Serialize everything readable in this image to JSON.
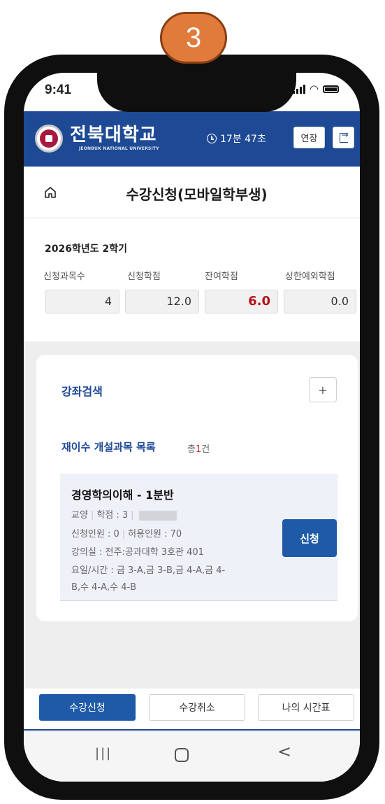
{
  "step_badge": "3",
  "status_bar": {
    "time": "9:41"
  },
  "header": {
    "university_name": "전북대학교",
    "university_name_en": "JEONBUK NATIONAL UNIVERSITY",
    "timer": "17분 47초",
    "extend_label": "연장",
    "brand_color": "#1e4a95"
  },
  "page": {
    "title": "수강신청(모바일학부생)"
  },
  "summary": {
    "term": "2026학년도 2학기",
    "items": [
      {
        "label": "신청과목수",
        "value": "4"
      },
      {
        "label": "신청학점",
        "value": "12.0"
      },
      {
        "label": "잔여학점",
        "value": "6.0"
      },
      {
        "label": "상한예외학점",
        "value": "0.0"
      }
    ]
  },
  "search": {
    "title": "강좌검색",
    "expand_label": "+"
  },
  "course_list": {
    "title": "재이수 개설과목 목록",
    "total_prefix": "총",
    "total_count": "1",
    "total_suffix": "건",
    "courses": [
      {
        "name": "경영학의이해 - 1분반",
        "category": "교양",
        "credits": "학점 : 3",
        "applicants": "신청인원 : 0",
        "capacity": "허용인원 : 70",
        "room": "강의실 : 전주:공과대학 3호관 401",
        "schedule_line1": "요일/시간 : 금 3-A,금 3-B,금 4-A,금 4-",
        "schedule_line2": "B,수 4-A,수 4-B",
        "apply_label": "신청"
      }
    ]
  },
  "bottom_tabs": [
    {
      "label": "수강신청",
      "active": true
    },
    {
      "label": "수강취소",
      "active": false
    },
    {
      "label": "나의 시간표",
      "active": false
    }
  ],
  "android_nav": {
    "recent": "|||",
    "back": "<"
  }
}
